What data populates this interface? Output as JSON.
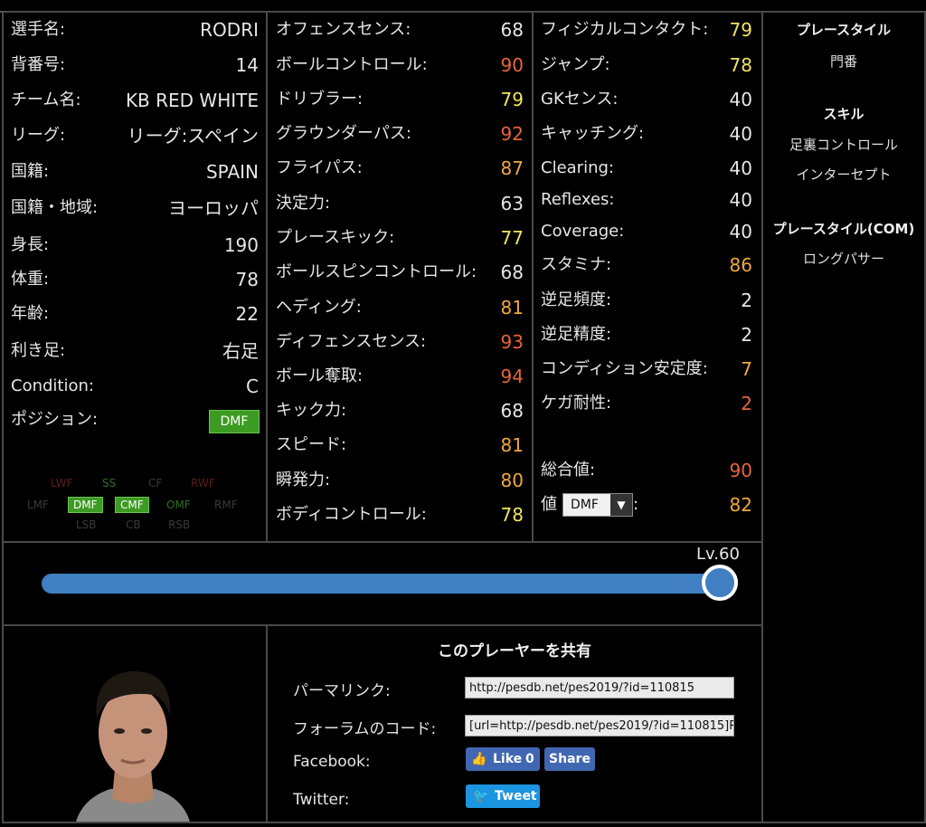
{
  "player": {
    "rows": [
      {
        "label": "選手名:",
        "value": "RODRI"
      },
      {
        "label": "背番号:",
        "value": "14"
      },
      {
        "label": "チーム名:",
        "value": "KB RED WHITE"
      },
      {
        "label": "リーグ:",
        "value": "リーグ:スペイン"
      },
      {
        "label": "国籍:",
        "value": "SPAIN"
      },
      {
        "label": "国籍・地域:",
        "value": "ヨーロッパ"
      },
      {
        "label": "身長:",
        "value": "190"
      },
      {
        "label": "体重:",
        "value": "78"
      },
      {
        "label": "年齢:",
        "value": "22"
      },
      {
        "label": "利き足:",
        "value": "右足"
      },
      {
        "label": "Condition:",
        "value": "C"
      }
    ],
    "position_label": "ポジション:",
    "position_value": "DMF",
    "position_map": {
      "row1": [
        "LWF",
        "SS",
        "CF",
        "RWF"
      ],
      "row2": [
        "LMF",
        "DMF",
        "CMF",
        "OMF",
        "RMF"
      ],
      "row3": [
        "LSB",
        "CB",
        "RSB"
      ]
    }
  },
  "stats_col1": [
    {
      "label": "オフェンスセンス:",
      "value": "68"
    },
    {
      "label": "ボールコントロール:",
      "value": "90"
    },
    {
      "label": "ドリブラー:",
      "value": "79"
    },
    {
      "label": "グラウンダーパス:",
      "value": "92"
    },
    {
      "label": "フライパス:",
      "value": "87"
    },
    {
      "label": "決定力:",
      "value": "63"
    },
    {
      "label": "プレースキック:",
      "value": "77"
    },
    {
      "label": "ボールスピンコントロール:",
      "value": "68"
    },
    {
      "label": "ヘディング:",
      "value": "81"
    },
    {
      "label": "ディフェンスセンス:",
      "value": "93"
    },
    {
      "label": "ボール奪取:",
      "value": "94"
    },
    {
      "label": "キック力:",
      "value": "68"
    },
    {
      "label": "スピード:",
      "value": "81"
    },
    {
      "label": "瞬発力:",
      "value": "80"
    },
    {
      "label": "ボディコントロール:",
      "value": "78"
    }
  ],
  "stats_col2": [
    {
      "label": "フィジカルコンタクト:",
      "value": "79"
    },
    {
      "label": "ジャンプ:",
      "value": "78"
    },
    {
      "label": "GKセンス:",
      "value": "40"
    },
    {
      "label": "キャッチング:",
      "value": "40"
    },
    {
      "label": "Clearing:",
      "value": "40"
    },
    {
      "label": "Reflexes:",
      "value": "40"
    },
    {
      "label": "Coverage:",
      "value": "40"
    },
    {
      "label": "スタミナ:",
      "value": "86"
    },
    {
      "label": "逆足頻度:",
      "value": "2"
    },
    {
      "label": "逆足精度:",
      "value": "2"
    },
    {
      "label": "コンディション安定度:",
      "value": "7"
    },
    {
      "label": "ケガ耐性:",
      "value": "2"
    }
  ],
  "overall": {
    "label": "総合値:",
    "value": "90"
  },
  "pos_rating": {
    "label": "値",
    "select": "DMF",
    "colon": ":",
    "value": "82"
  },
  "side": {
    "playstyle_title": "プレースタイル",
    "playstyle": "門番",
    "skills_title": "スキル",
    "skills": [
      "足裏コントロール",
      "インターセプト"
    ],
    "com_title": "プレースタイル(COM)",
    "com": [
      "ロングパサー"
    ]
  },
  "level": {
    "label": "Lv.60",
    "fraction": 1.0
  },
  "share": {
    "title": "このプレーヤーを共有",
    "permalink_label": "パーマリンク:",
    "permalink_value": "http://pesdb.net/pes2019/?id=110815",
    "forum_label": "フォーラムのコード:",
    "forum_value": "[url=http://pesdb.net/pes2019/?id=110815]R",
    "facebook_label": "Facebook:",
    "like_label": "Like",
    "like_count": "0",
    "share_label": "Share",
    "twitter_label": "Twitter:",
    "tweet_label": "Tweet"
  },
  "colors": {
    "accent": "#3f7fc2",
    "position_green": "#3c9b22",
    "stat_yellow": "#f2e45c",
    "stat_orange": "#f0a840",
    "stat_red": "#e8653a"
  }
}
